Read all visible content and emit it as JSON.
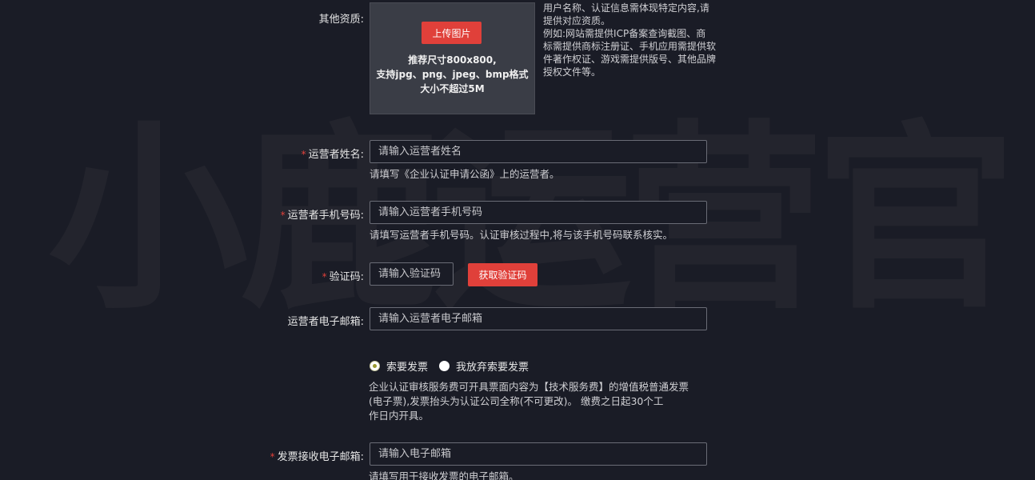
{
  "watermark": "小鹿运营官",
  "other_qualification": {
    "label": "其他资质:",
    "upload_button": "上传图片",
    "upload_hint_lines": [
      "推荐尺寸800x800,",
      "支持jpg、png、jpeg、bmp格式",
      "大小不超过5M"
    ],
    "note_lines": [
      "用户名称、认证信息需体现特定内容,请",
      "提供对应资质。",
      "例如:网站需提供ICP备案查询截图、商",
      "标需提供商标注册证、手机应用需提供软",
      "件著作权证、游戏需提供版号、其他品牌",
      "授权文件等。"
    ]
  },
  "operator_name": {
    "required": "*",
    "label": "运营者姓名:",
    "placeholder": "请输入运营者姓名",
    "help": "请填写《企业认证申请公函》上的运营者。"
  },
  "operator_phone": {
    "required": "*",
    "label": "运营者手机号码:",
    "placeholder": "请输入运营者手机号码",
    "help": "请填写运营者手机号码。认证审核过程中,将与该手机号码联系核实。"
  },
  "verification_code": {
    "required": "*",
    "label": "验证码:",
    "placeholder": "请输入验证码",
    "button": "获取验证码"
  },
  "operator_email": {
    "label": "运营者电子邮箱:",
    "placeholder": "请输入运营者电子邮箱"
  },
  "invoice": {
    "option_request": "索要发票",
    "option_waive": "我放弃索要发票",
    "selected": "索要发票",
    "note_lines": [
      "企业认证审核服务费可开具票面内容为【技术服务费】的增值税普通发票",
      "(电子票),发票抬头为认证公司全称(不可更改)。 缴费之日起30个工",
      "作日内开具。"
    ]
  },
  "invoice_email": {
    "required": "*",
    "label": "发票接收电子邮箱:",
    "placeholder": "请输入电子邮箱",
    "help": "请填写用于接收发票的电子邮箱。"
  },
  "colors": {
    "background": "#1a1c26",
    "accent_red": "#e0403a",
    "upload_box": "#3a3d46"
  }
}
